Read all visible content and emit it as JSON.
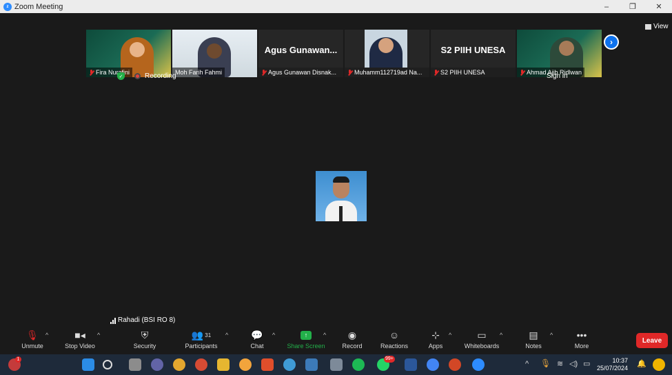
{
  "window": {
    "title": "Zoom Meeting",
    "minimize": "–",
    "restore": "❐",
    "close": "✕"
  },
  "meeting": {
    "view_label": "View",
    "status": {
      "recording_label": "Recording"
    },
    "sign_in": "Sign in",
    "active_speaker": "Rahadi (BSI RO 8)",
    "participants": [
      {
        "name": "Fira Nurafini",
        "video": true,
        "muted": true
      },
      {
        "name": "Moh Farih Fahmi",
        "video": true,
        "muted": false
      },
      {
        "name": "Agus Gunawan Disnak...",
        "display_title": "Agus Gunawan...",
        "video": false,
        "muted": true
      },
      {
        "name": "Muhamm112719ad Na...",
        "video": true,
        "muted": true
      },
      {
        "name": "S2 PIIH UNESA",
        "display_title": "S2 PIIH UNESA",
        "video": false,
        "muted": true
      },
      {
        "name": "Ahmad Ajib Ridlwan",
        "video": true,
        "muted": true
      }
    ]
  },
  "toolbar": {
    "unmute": "Unmute",
    "stop_video": "Stop Video",
    "security": "Security",
    "participants": "Participants",
    "participants_count": "31",
    "chat": "Chat",
    "share_screen": "Share Screen",
    "record": "Record",
    "reactions": "Reactions",
    "apps": "Apps",
    "whiteboards": "Whiteboards",
    "notes": "Notes",
    "more": "More",
    "leave": "Leave"
  },
  "taskbar": {
    "time": "10:37",
    "date": "25/07/2024",
    "notification_badge": "99+",
    "weather_badge": "1"
  },
  "colors": {
    "accent": "#0e72ed",
    "leave": "#e02828",
    "share": "#23b04a"
  }
}
